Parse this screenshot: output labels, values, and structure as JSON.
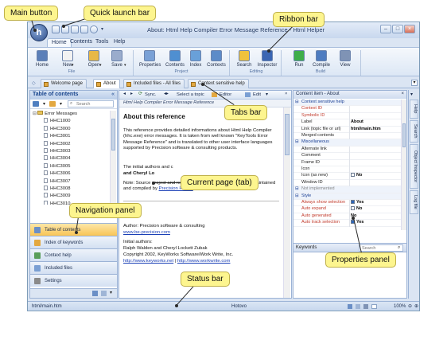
{
  "window": {
    "title": "About: Html Help Compiler Error Message Reference - Html Helper"
  },
  "main_button": {
    "glyph": "h"
  },
  "ribbon": {
    "tabs": [
      "Home",
      "Contents",
      "Tools",
      "Help"
    ],
    "buttons": [
      {
        "label": "Home",
        "icon": "home-icon",
        "color": "#5b7fb8"
      },
      {
        "label": "New",
        "icon": "new-document-icon",
        "color": "#f2f2f2"
      },
      {
        "label": "Open",
        "icon": "open-folder-icon",
        "color": "#e8b847"
      },
      {
        "label": "Save",
        "icon": "save-disk-icon",
        "color": "#9aaccc"
      },
      {
        "label": "Properties",
        "icon": "properties-icon",
        "color": "#7aa1d6"
      },
      {
        "label": "Contents",
        "icon": "contents-icon",
        "color": "#4f8fd1"
      },
      {
        "label": "Index",
        "icon": "index-icon",
        "color": "#69a0d9"
      },
      {
        "label": "Contexts",
        "icon": "contexts-icon",
        "color": "#5c8bc8"
      },
      {
        "label": "Search",
        "icon": "search-icon",
        "color": "#f0c23c"
      },
      {
        "label": "Inspector",
        "icon": "inspector-icon",
        "color": "#3b66b3"
      },
      {
        "label": "Run",
        "icon": "run-icon",
        "color": "#3fae4a"
      },
      {
        "label": "Compile",
        "icon": "compile-icon",
        "color": "#4e7cc0"
      },
      {
        "label": "View",
        "icon": "view-icon",
        "color": "#7f93b5"
      }
    ],
    "groups": [
      "File",
      "Project",
      "Editing",
      "Build"
    ]
  },
  "doc_tabs": [
    "Welcome page",
    "About",
    "Included files - All files",
    "Context sensitive help"
  ],
  "nav_panel": {
    "title": "Table of contents",
    "search_placeholder": "Search",
    "tree_root": "Error Messages",
    "tree_items": [
      "HHC1000",
      "HHC3000",
      "HHC3001",
      "HHC3002",
      "HHC3003",
      "HHC3004",
      "HHC3005",
      "HHC3006",
      "HHC3007",
      "HHC3008",
      "HHC3009",
      "HHC3010"
    ],
    "buttons": [
      "Table of contents",
      "Index of keywords",
      "Context help",
      "Included files",
      "Settings"
    ]
  },
  "content": {
    "toolbar": {
      "sync": "Sync.",
      "select_topic": "Select a topic",
      "editor": "Editor",
      "edit": "Edit"
    },
    "breadcrumb": "Html Help Compiler Error Message Reference",
    "heading": "About this reference",
    "paragraph1": "This reference provides detailed informations about Html Help Compiler (hhc.exe) error messages. It is taken from well known \"KeyTools Error Message Reference\" and is translated to other user interface languages supported by Precision software & consulting products.",
    "paragraph2a": "The initial authors and c",
    "paragraph2b": "and Cheryl Lo",
    "note": "Note: Source project and resulting help file of this reference is maintained and compiled by",
    "note_link": "Precision Helper",
    "note_end": "product.",
    "author_line": "Author: Precision software & consulting",
    "author_link": "www.be-precision.com",
    "initial_authors_label": "Initial authors:",
    "initial_authors": "Ralph Walden and Cheryl Lockett Zubak",
    "copyright": "Copyright 2002, KeyWorks Software/Work Write, Inc.",
    "link1": "http://www.keyworks.net",
    "link_sep": "|",
    "link2": "http://www.workwrite.com"
  },
  "properties": {
    "title": "Content item - About",
    "rows": [
      {
        "type": "cat",
        "name": "Context sensitive help",
        "value": ""
      },
      {
        "type": "prop",
        "name": "Context ID",
        "value": "",
        "red": true
      },
      {
        "type": "prop",
        "name": "Symbolic ID",
        "value": "",
        "red": true
      },
      {
        "type": "prop",
        "name": "Label",
        "value": "About"
      },
      {
        "type": "prop",
        "name": "Link (topic file or url)",
        "value": "html/main.htm"
      },
      {
        "type": "prop",
        "name": "Merged contents",
        "value": ""
      },
      {
        "type": "cat",
        "name": "Miscellaneous",
        "value": ""
      },
      {
        "type": "prop",
        "name": "Alternate link",
        "value": ""
      },
      {
        "type": "prop",
        "name": "Comment",
        "value": ""
      },
      {
        "type": "prop",
        "name": "Frame ID",
        "value": ""
      },
      {
        "type": "prop",
        "name": "Icon",
        "value": ""
      },
      {
        "type": "prop",
        "name": "Icon (as new)",
        "value": "No",
        "check": true
      },
      {
        "type": "prop",
        "name": "Window ID",
        "value": ""
      },
      {
        "type": "cat",
        "name": "Not implemented",
        "value": "",
        "gray": true
      },
      {
        "type": "cat",
        "name": "Style",
        "value": ""
      },
      {
        "type": "prop",
        "name": "Always show selection",
        "value": "Yes",
        "check": true,
        "red": true
      },
      {
        "type": "prop",
        "name": "Auto expand",
        "value": "No",
        "check": true,
        "red": true
      },
      {
        "type": "prop",
        "name": "Auto generated",
        "value": "No",
        "red": true
      },
      {
        "type": "prop",
        "name": "Auto track selection",
        "value": "Yes",
        "check": true,
        "red": true
      }
    ],
    "keywords_label": "Keywords",
    "search_placeholder": "Search"
  },
  "right_tabs": [
    "Help",
    "Search",
    "Object Inspector",
    "Log file"
  ],
  "status": {
    "path": "html/main.htm",
    "mode": "Hotovo",
    "zoom": "100%"
  },
  "callouts": {
    "main_button": "Main button",
    "quick_launch": "Quick launch bar",
    "ribbon": "Ribbon bar",
    "tabs": "Tabs bar",
    "current_page": "Current page (tab)",
    "navigation": "Navigation panel",
    "properties": "Properties panel",
    "status": "Status bar"
  },
  "colors": {
    "accent": "#15428b",
    "callout_bg": "#fdf58f",
    "link": "#1a3fb6"
  }
}
